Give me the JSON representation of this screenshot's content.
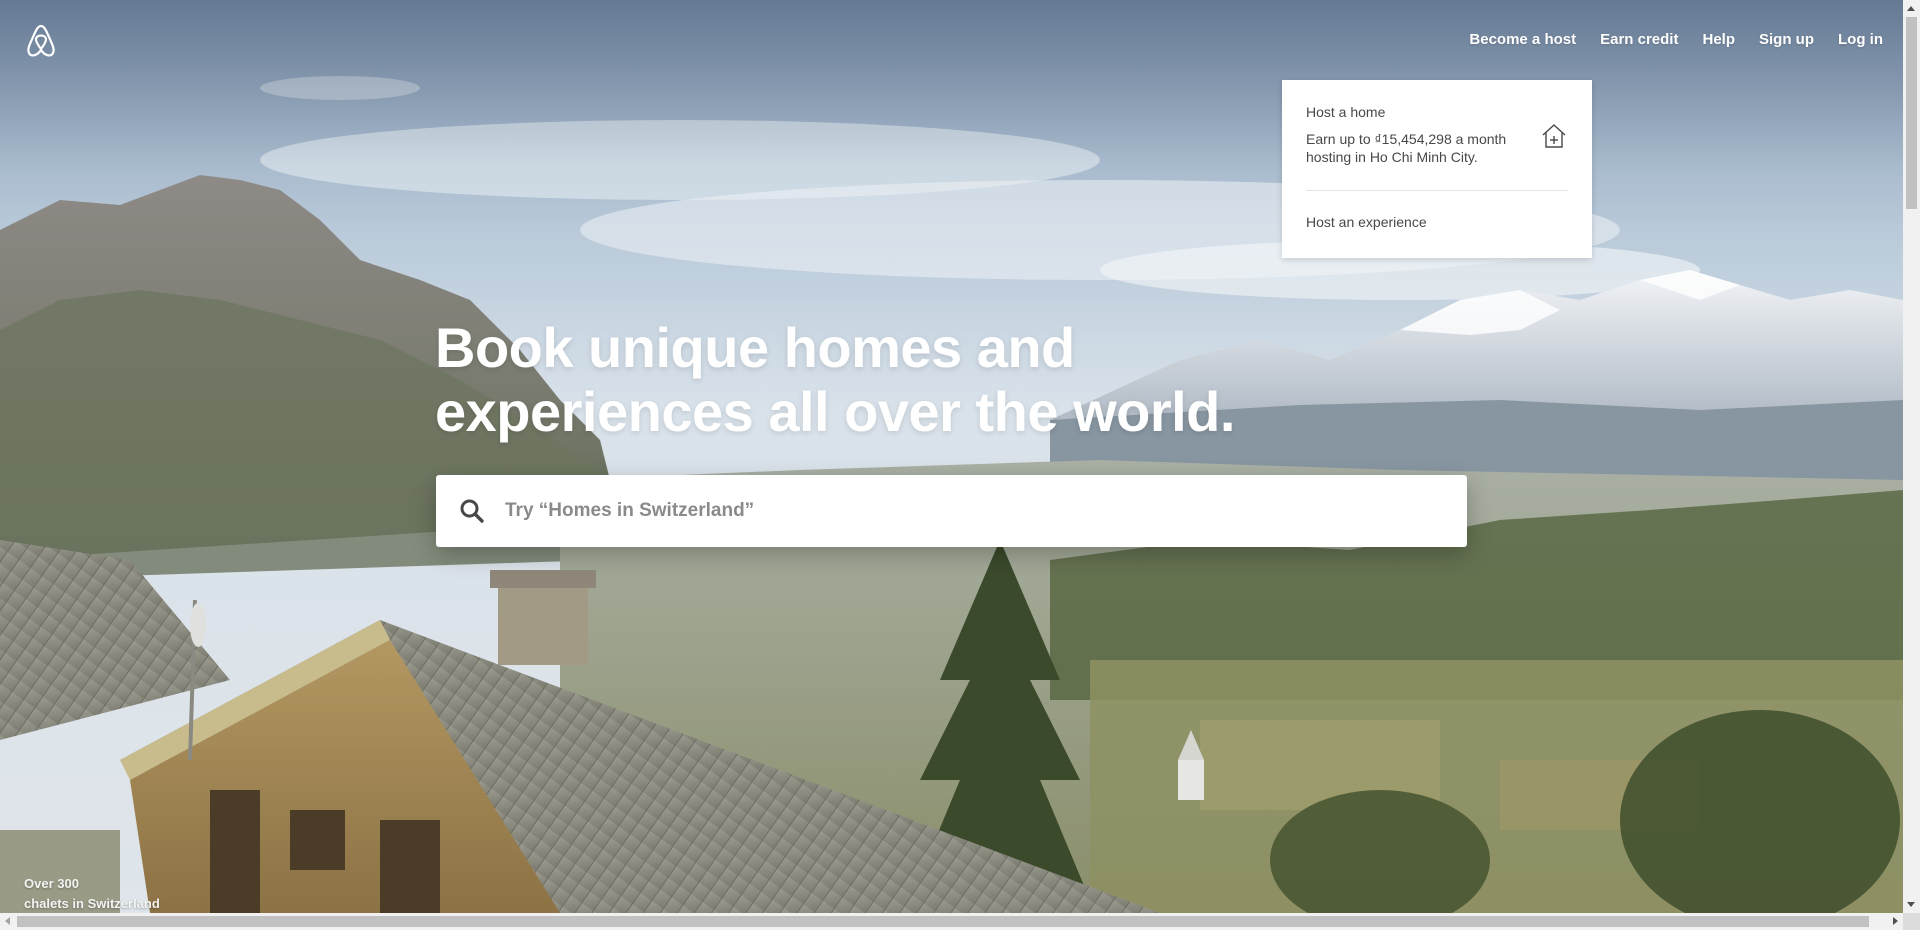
{
  "nav": {
    "logo": "airbnb-logo-icon",
    "items": [
      {
        "label": "Become a host"
      },
      {
        "label": "Earn credit"
      },
      {
        "label": "Help"
      },
      {
        "label": "Sign up"
      },
      {
        "label": "Log in"
      }
    ]
  },
  "host_menu": {
    "home_title": "Host a home",
    "home_description": "Earn up to ₫15,454,298 a month hosting in Ho Chi Minh City.",
    "home_icon": "house-plus-icon",
    "experience_title": "Host an experience"
  },
  "hero": {
    "headline": "Book unique homes and experiences all over the world.",
    "search_placeholder": "Try “Homes in Switzerland”",
    "search_icon": "search-icon",
    "caption_line1": "Over 300",
    "caption_line2": "chalets in Switzerland"
  },
  "colors": {
    "nav_text": "#ffffff",
    "menu_text": "#484848",
    "placeholder": "#8a8a8a"
  }
}
